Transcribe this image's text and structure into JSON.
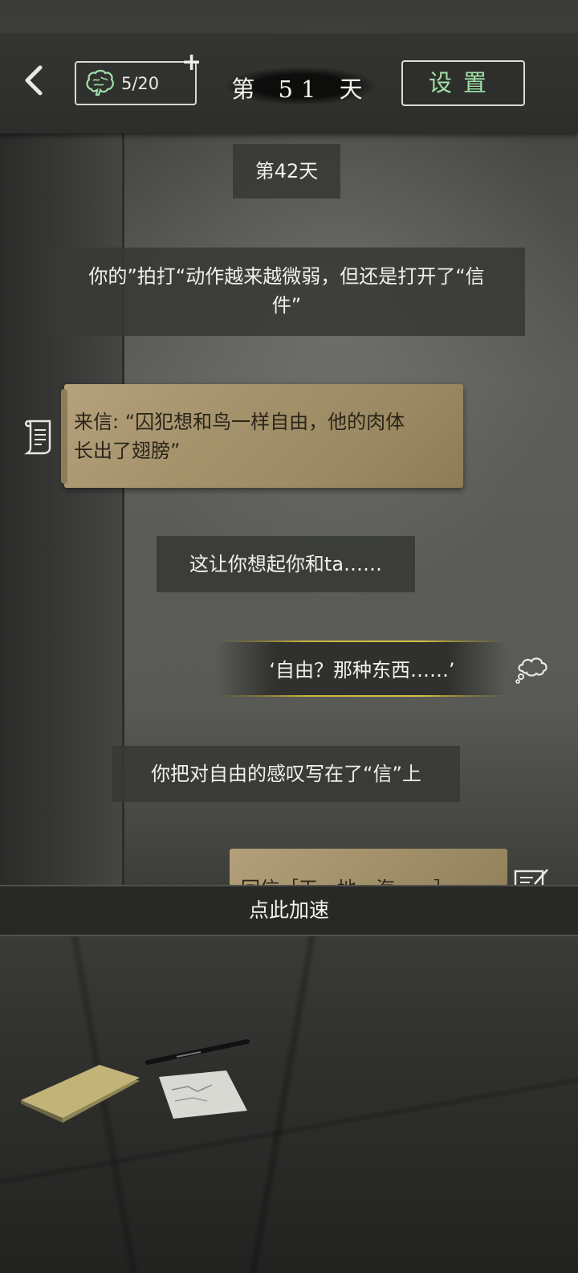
{
  "header": {
    "brain_count": "5/20",
    "plus": "+",
    "day_title": "第 51 天",
    "settings_label": "设置"
  },
  "messages": {
    "day_marker": "第42天",
    "narration_1_line1": "你的”拍打“动作越来越微弱，但还是打开了“信",
    "narration_1_line2": "件”",
    "letter_line1": "来信: “囚犯想和鸟一样自由，他的肉体",
    "letter_line2": "长出了翅膀”",
    "narration_2": "这让你想起你和ta……",
    "thought": "‘自由？那种东西……’",
    "narration_3": "你把对自由的感叹写在了“信”上",
    "reply_partial": "回信［天　地　海　　］"
  },
  "footer": {
    "speed_up_label": "点此加速"
  },
  "icons": [
    "back-arrow-icon",
    "brain-icon",
    "scroll-icon",
    "thought-cloud-icon",
    "edit-letter-icon"
  ],
  "colors": {
    "accent_green": "#9fe0a8",
    "letter_paper": "#a4926b",
    "thought_border": "#c9b63a"
  }
}
